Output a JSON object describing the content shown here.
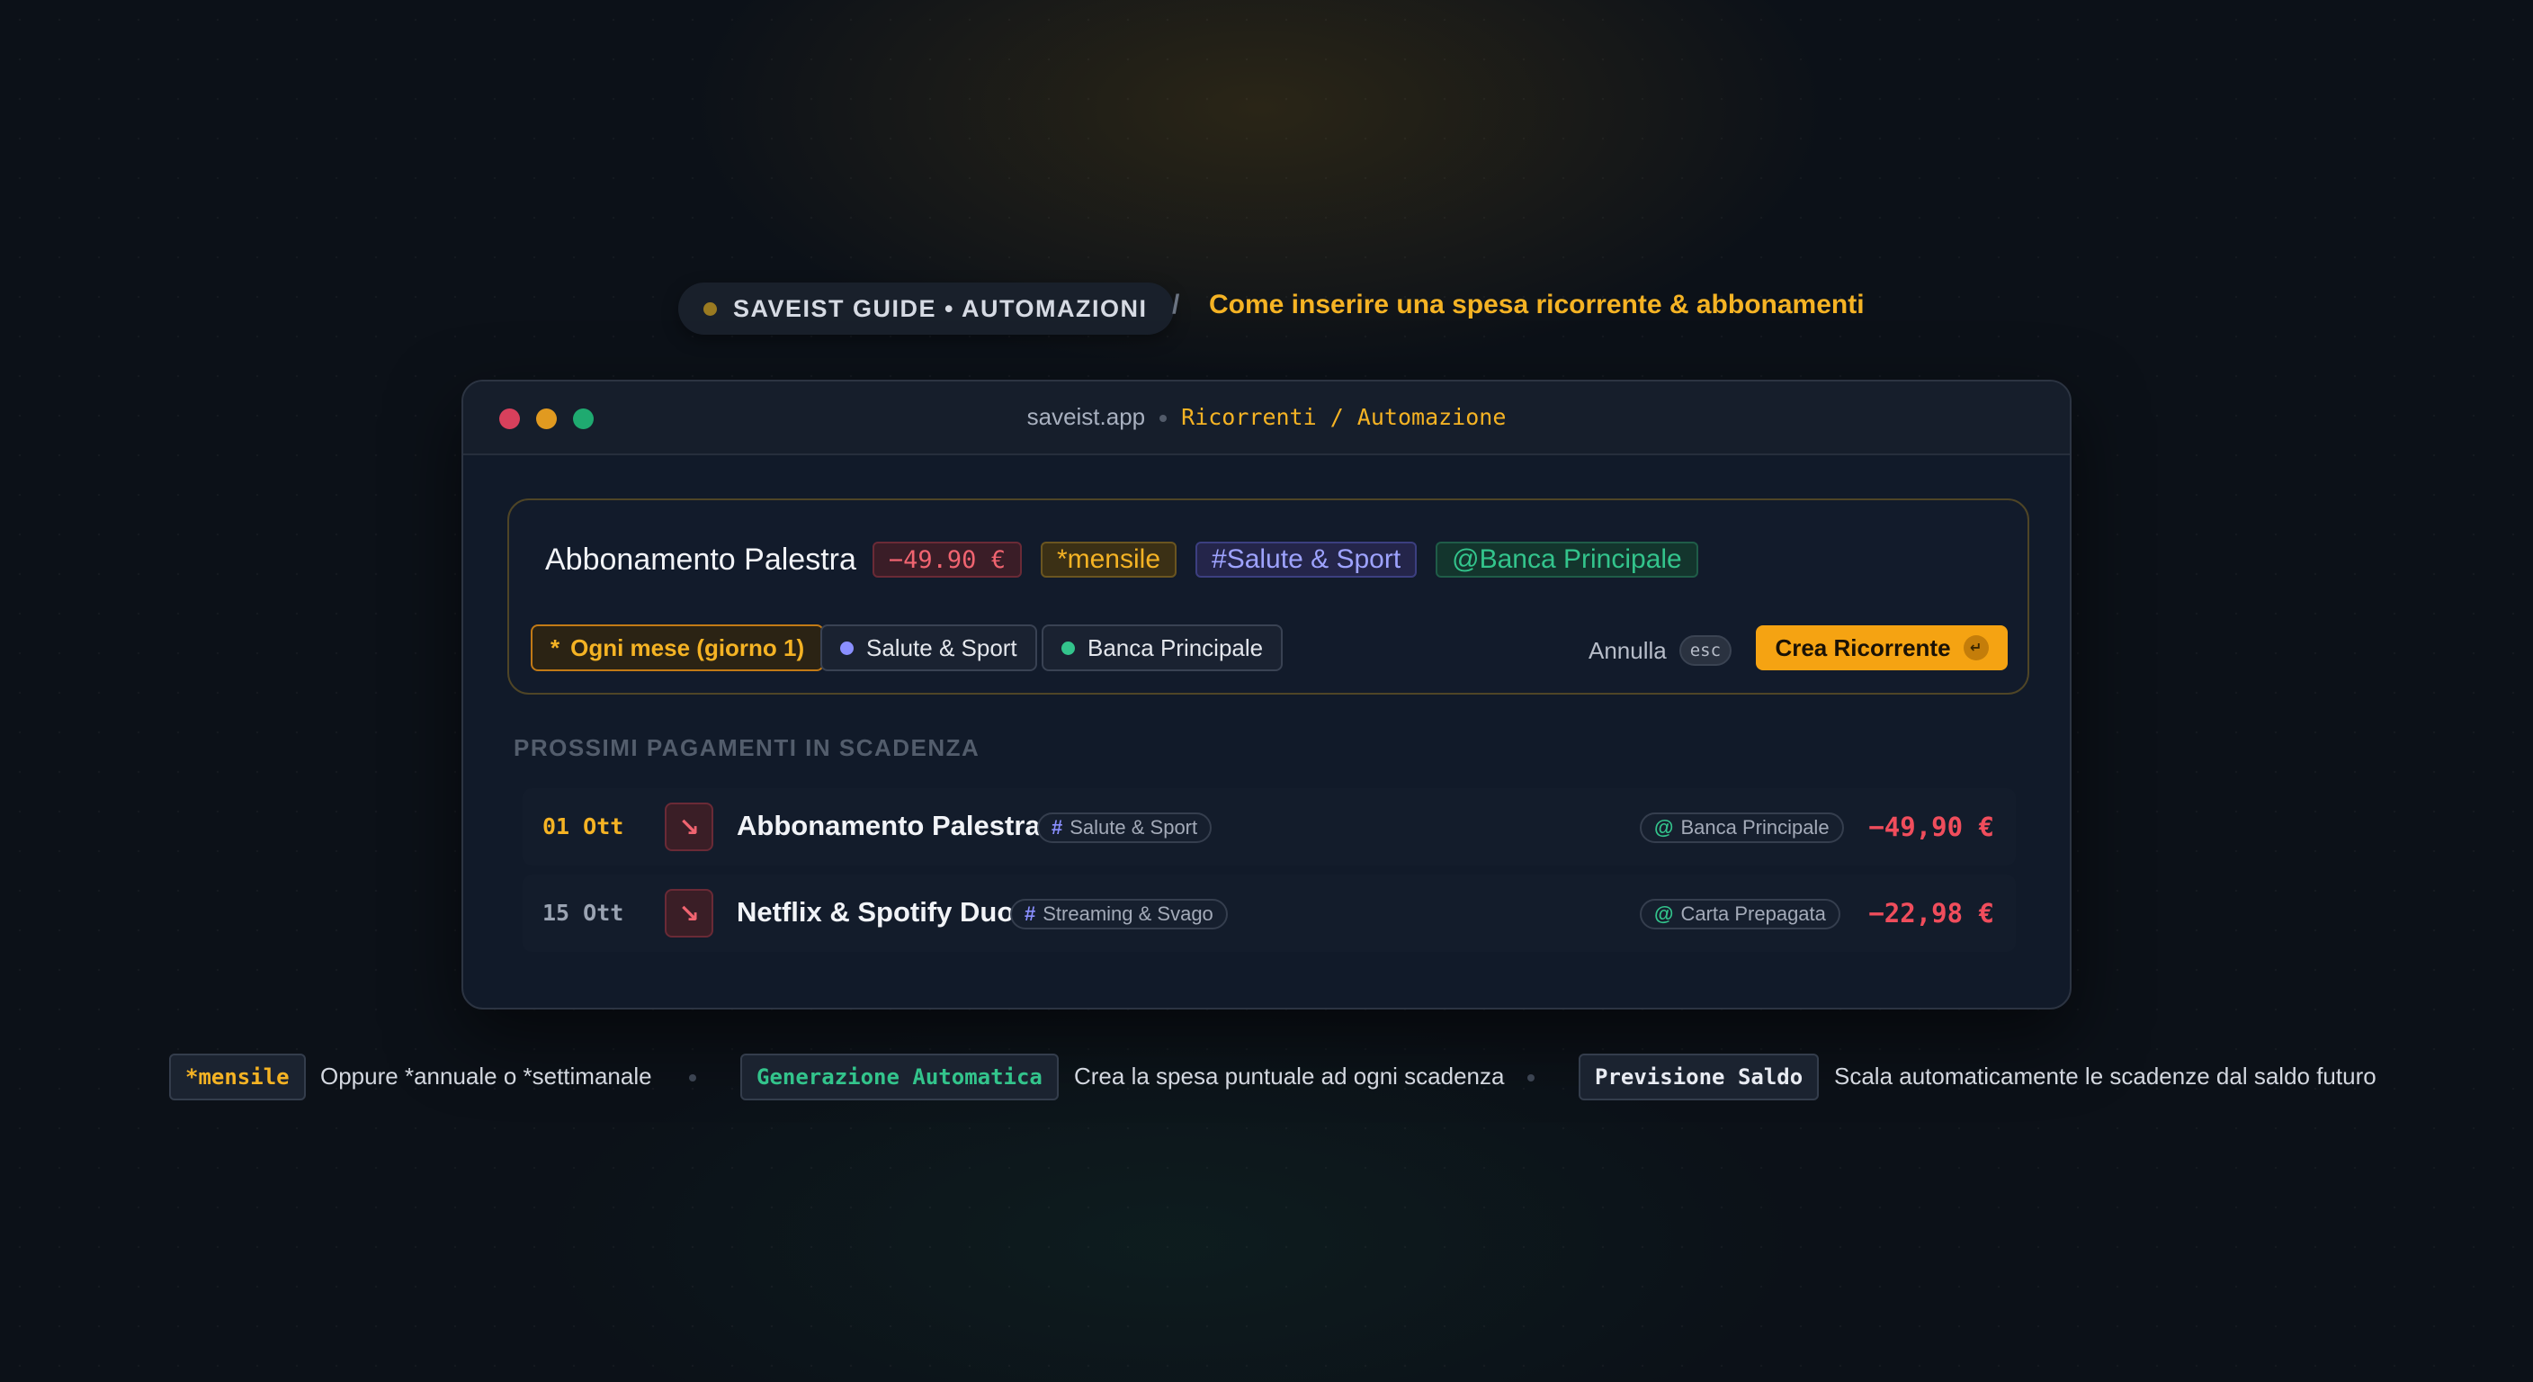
{
  "header": {
    "guide_label": "SAVEIST GUIDE • AUTOMAZIONI",
    "separator": "/",
    "subtitle": "Come inserire una spesa ricorrente & abbonamenti"
  },
  "window": {
    "domain": "saveist.app",
    "path": "Ricorrenti / Automazione"
  },
  "input": {
    "title": "Abbonamento Palestra",
    "amount_token": "−49.90 €",
    "frequency_token": "*mensile",
    "category_token": "#Salute & Sport",
    "account_token": "@Banca Principale",
    "chips": {
      "frequency_icon": "*",
      "frequency": "Ogni mese (giorno 1)",
      "category": "Salute & Sport",
      "account": "Banca Principale"
    },
    "cancel_label": "Annulla",
    "esc_key": "esc",
    "create_label": "Crea Ricorrente",
    "enter_key": "↵"
  },
  "upcoming": {
    "title": "PROSSIMI PAGAMENTI IN SCADENZA",
    "rows": [
      {
        "date": "01 Ott",
        "icon": "↘",
        "title": "Abbonamento Palestra",
        "category": "Salute & Sport",
        "account": "Banca Principale",
        "amount": "−49,90 €"
      },
      {
        "date": "15 Ott",
        "icon": "↘",
        "title": "Netflix & Spotify Duo",
        "category": "Streaming & Svago",
        "account": "Carta Prepagata",
        "amount": "−22,98 €"
      }
    ]
  },
  "footer": {
    "items": [
      {
        "key": "*mensile",
        "text": "Oppure *annuale o *settimanale"
      },
      {
        "key": "Generazione Automatica",
        "text": "Crea la spesa puntuale ad ogni scadenza"
      },
      {
        "key": "Previsione Saldo",
        "text": "Scala automaticamente le scadenze dal saldo futuro"
      }
    ]
  },
  "colors": {
    "accent": "#f5b324",
    "expense": "#f04d5c",
    "category": "#9ea3ff",
    "account": "#33c48c"
  }
}
